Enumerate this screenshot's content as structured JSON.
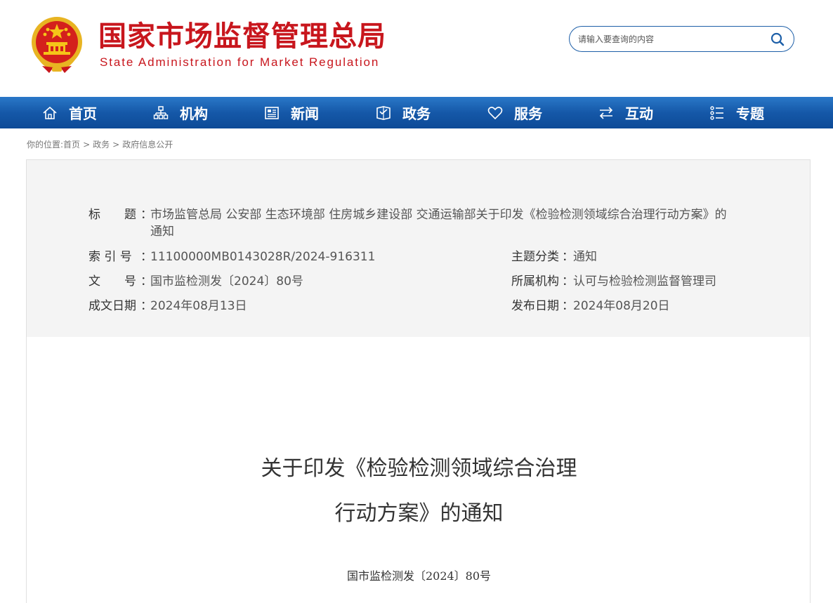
{
  "header": {
    "title_cn": "国家市场监督管理总局",
    "title_en": "State Administration for Market Regulation",
    "brand_color": "#c8161d",
    "emblem_icon": "national-emblem-icon"
  },
  "search": {
    "placeholder": "请输入要查询的内容",
    "button_icon": "search-icon"
  },
  "nav": {
    "items": [
      {
        "label": "首页",
        "icon": "home-icon"
      },
      {
        "label": "机构",
        "icon": "org-chart-icon"
      },
      {
        "label": "新闻",
        "icon": "news-icon"
      },
      {
        "label": "政务",
        "icon": "government-affairs-icon"
      },
      {
        "label": "服务",
        "icon": "heart-icon"
      },
      {
        "label": "互动",
        "icon": "exchange-arrows-icon"
      },
      {
        "label": "专题",
        "icon": "topic-list-icon"
      }
    ],
    "color": "#1558a8"
  },
  "breadcrumb": {
    "prefix": "你的位置:",
    "items": [
      "首页",
      "政务",
      "政府信息公开"
    ],
    "separator": ">"
  },
  "meta": {
    "title_label": "标　　题",
    "title_value_line1": "市场监管总局 公安部 生态环境部 住房城乡建设部 交通运输部关于印发《检验检测领域综合治理行动方案》的",
    "title_value_line2": "通知",
    "index_label": "索 引 号",
    "index_value": "11100000MB0143028R/2024-916311",
    "doc_label": "文　　号",
    "doc_value": "国市监检测发〔2024〕80号",
    "created_label": "成文日期",
    "created_value": "2024年08月13日",
    "topic_label": "主题分类",
    "topic_value": "通知",
    "org_label": "所属机构",
    "org_value": "认可与检验检测监督管理司",
    "published_label": "发布日期",
    "published_value": "2024年08月20日",
    "colon": "："
  },
  "article": {
    "title_line1": "关于印发《检验检测领域综合治理",
    "title_line2": "行动方案》的通知",
    "doc_number": "国市监检测发〔2024〕80号"
  }
}
